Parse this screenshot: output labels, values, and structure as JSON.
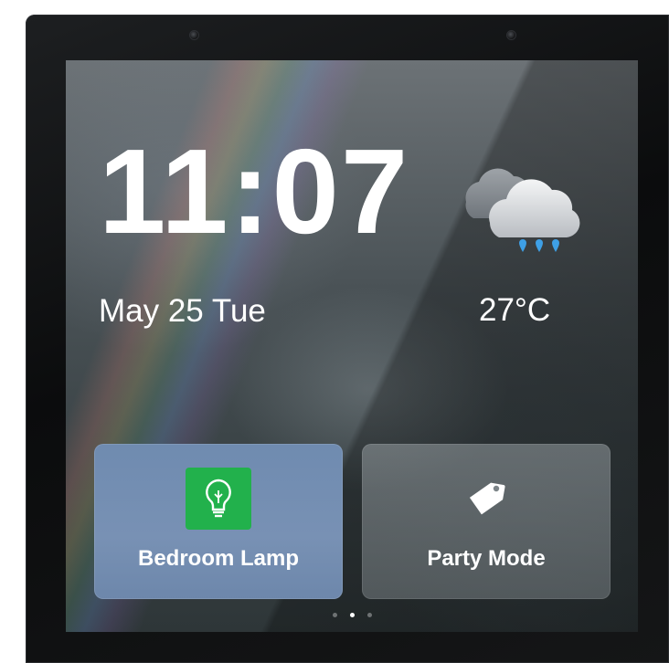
{
  "device": {
    "cameras": [
      "camera-left",
      "camera-right"
    ]
  },
  "home_screen": {
    "time": "11:07",
    "date": "May 25 Tue",
    "weather": {
      "condition_icon": "rain-cloud-icon",
      "temperature": "27°C"
    },
    "tiles": [
      {
        "label": "Bedroom Lamp",
        "icon": "lightbulb-icon",
        "icon_bg": "#22b14c"
      },
      {
        "label": "Party Mode",
        "icon": "tag-icon"
      }
    ],
    "pager": {
      "pages": 3,
      "active_index": 1
    }
  }
}
